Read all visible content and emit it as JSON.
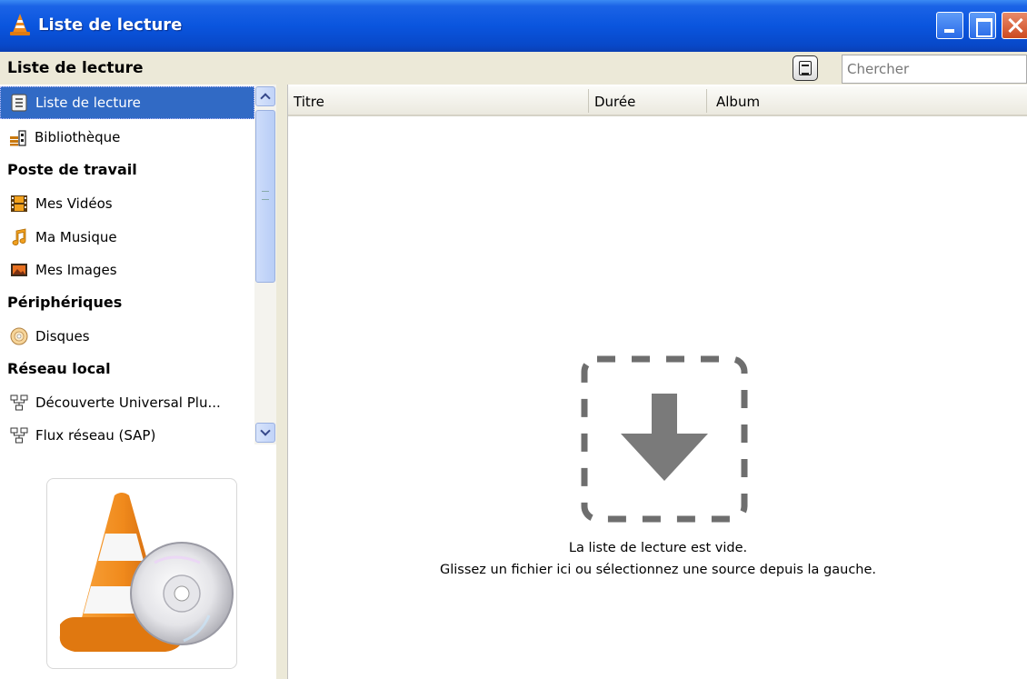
{
  "window": {
    "title": "Liste de lecture"
  },
  "header": {
    "panel_title": "Liste de lecture",
    "search_placeholder": "Chercher"
  },
  "sidebar": {
    "items": [
      {
        "label": "Liste de lecture",
        "icon": "playlist-icon",
        "selected": true
      },
      {
        "label": "Bibliothèque",
        "icon": "library-icon"
      }
    ],
    "sections": [
      {
        "title": "Poste de travail",
        "items": [
          {
            "label": "Mes Vidéos",
            "icon": "film-icon"
          },
          {
            "label": "Ma Musique",
            "icon": "music-note-icon"
          },
          {
            "label": "Mes Images",
            "icon": "image-icon"
          }
        ]
      },
      {
        "title": "Périphériques",
        "items": [
          {
            "label": "Disques",
            "icon": "disc-icon"
          }
        ]
      },
      {
        "title": "Réseau local",
        "items": [
          {
            "label": "Découverte Universal Plu...",
            "icon": "network-icon"
          },
          {
            "label": "Flux réseau (SAP)",
            "icon": "network-icon"
          }
        ]
      }
    ]
  },
  "playlist": {
    "columns": [
      "Titre",
      "Durée",
      "Album"
    ],
    "empty_line1": "La liste de lecture est vide.",
    "empty_line2": "Glissez un fichier ici ou sélectionnez une source depuis la gauche."
  },
  "colors": {
    "titlebar": "#0a55de",
    "selection": "#316ac5",
    "cone_orange": "#f08a1c"
  }
}
